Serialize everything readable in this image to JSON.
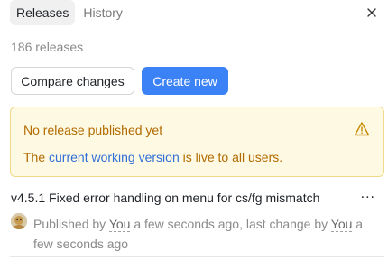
{
  "tabs": [
    {
      "label": "Releases",
      "active": true
    },
    {
      "label": "History",
      "active": false
    }
  ],
  "icons": {
    "close": "close-icon",
    "warning": "warning-triangle-icon",
    "more": "more-horizontal-icon"
  },
  "release_count": "186 releases",
  "buttons": {
    "compare": "Compare changes",
    "create": "Create new"
  },
  "warning": {
    "title": "No release published yet",
    "text_before": "The ",
    "link": "current working version",
    "text_after": " is live to all users."
  },
  "release": {
    "title": "v4.5.1 Fixed error handling on menu for cs/fg mismatch",
    "more": "...",
    "published_prefix": "Published by ",
    "publisher": "You",
    "published_time": " a few seconds ago, last change by ",
    "changer": "You",
    "changed_time": " a few seconds ago"
  },
  "colors": {
    "primary": "#3b82f6",
    "warning_bg": "#fef9e3",
    "warning_text": "#b26b00",
    "link": "#2f6fd6"
  }
}
